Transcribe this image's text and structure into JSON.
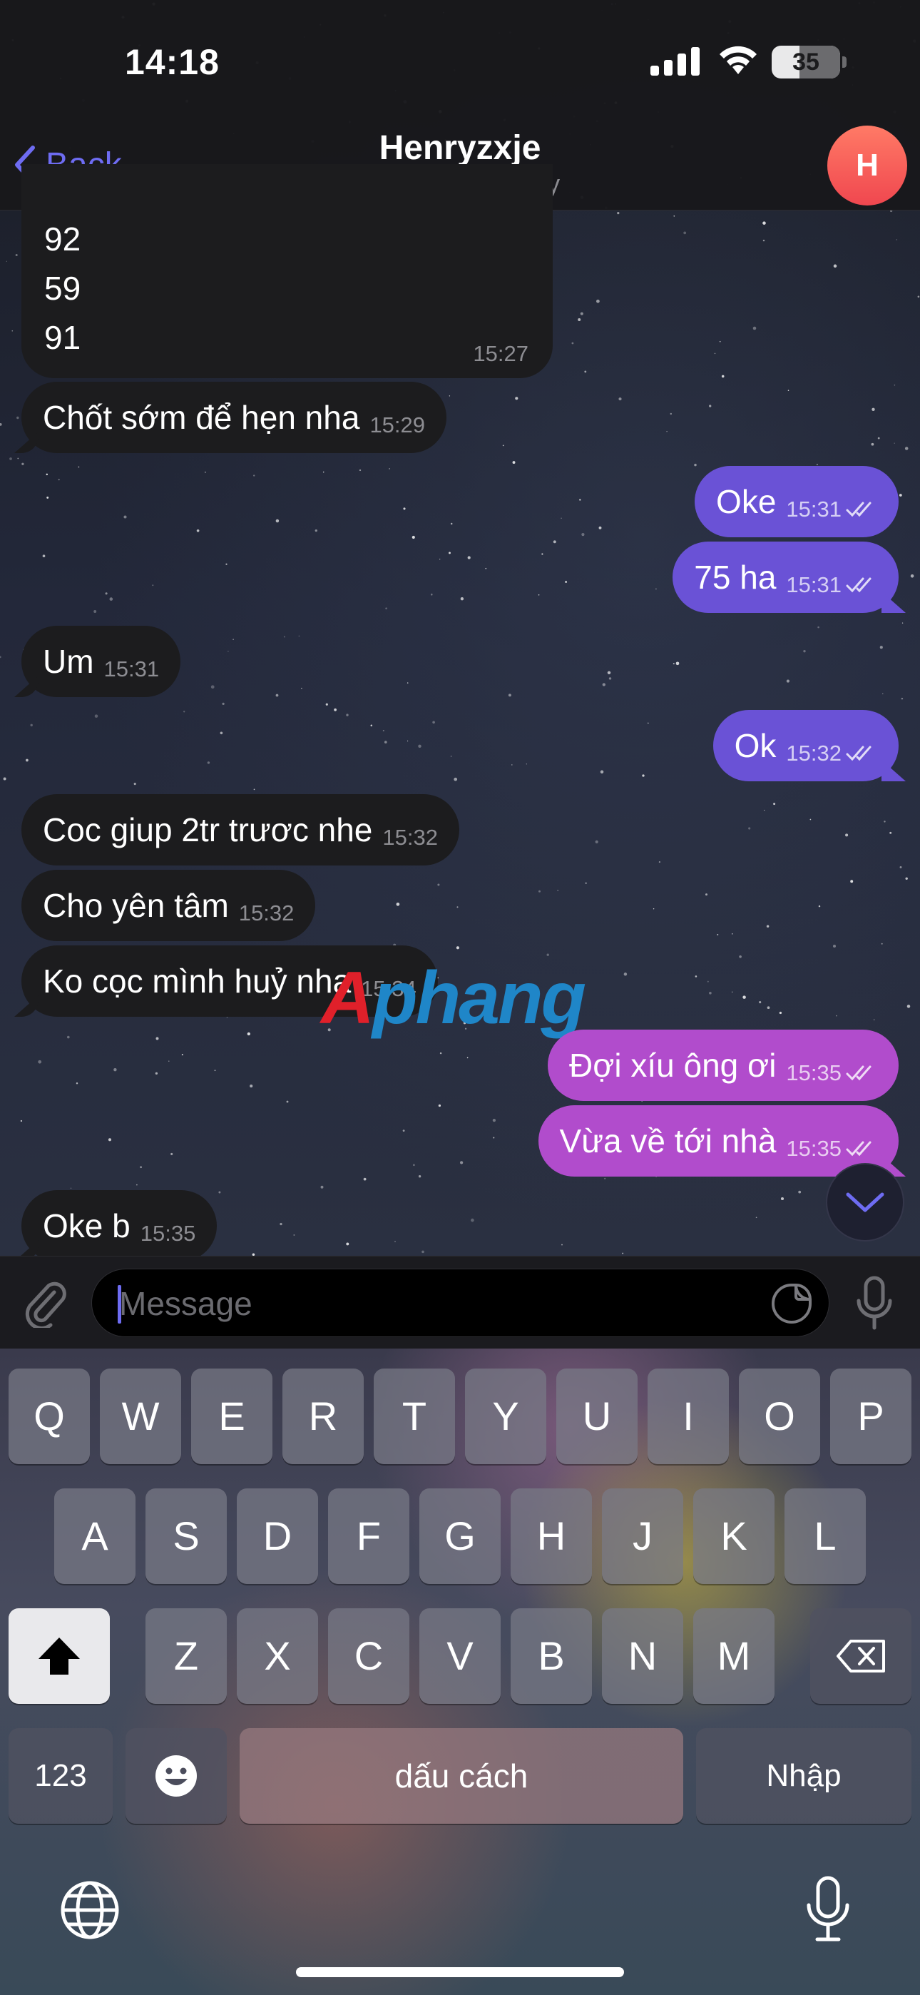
{
  "status_bar": {
    "time": "14:18",
    "battery": "35"
  },
  "header": {
    "back_label": "Back",
    "title": "Henryzxje",
    "subtitle": "last seen recently",
    "avatar_initial": "H"
  },
  "chat": {
    "block_message": {
      "lines": [
        "92",
        "59",
        "91"
      ],
      "time": "15:27"
    },
    "messages": [
      {
        "text": "Chốt sớm để hẹn nha",
        "time": "15:29",
        "direction": "in"
      },
      {
        "text": "Oke",
        "time": "15:31",
        "direction": "out"
      },
      {
        "text": "75 ha",
        "time": "15:31",
        "direction": "out"
      },
      {
        "text": "Um",
        "time": "15:31",
        "direction": "in"
      },
      {
        "text": "Ok",
        "time": "15:32",
        "direction": "out"
      },
      {
        "text": "Coc giup 2tr trươc nhe",
        "time": "15:32",
        "direction": "in"
      },
      {
        "text": "Cho yên tâm",
        "time": "15:32",
        "direction": "in"
      },
      {
        "text": "Ko cọc mình huỷ nha",
        "time": "15:34",
        "direction": "in"
      },
      {
        "text": "Đợi xíu ông ơi",
        "time": "15:35",
        "direction": "out"
      },
      {
        "text": "Vừa về tới nhà",
        "time": "15:35",
        "direction": "out"
      },
      {
        "text": "Oke b",
        "time": "15:35",
        "direction": "in"
      }
    ]
  },
  "watermark": {
    "first": "A",
    "rest": "phang"
  },
  "input": {
    "placeholder": "Message"
  },
  "keyboard": {
    "row1": [
      "Q",
      "W",
      "E",
      "R",
      "T",
      "Y",
      "U",
      "I",
      "O",
      "P"
    ],
    "row2": [
      "A",
      "S",
      "D",
      "F",
      "G",
      "H",
      "J",
      "K",
      "L"
    ],
    "row3": [
      "Z",
      "X",
      "C",
      "V",
      "B",
      "N",
      "M"
    ],
    "numbers_label": "123",
    "space_label": "dấu cách",
    "return_label": "Nhập"
  },
  "colors": {
    "accent": "#6e6cf2",
    "outgoing": "#6a52d6",
    "outgoing_pink": "#b14ccc",
    "incoming": "#1c1c1e",
    "avatar": "#f0474f"
  }
}
